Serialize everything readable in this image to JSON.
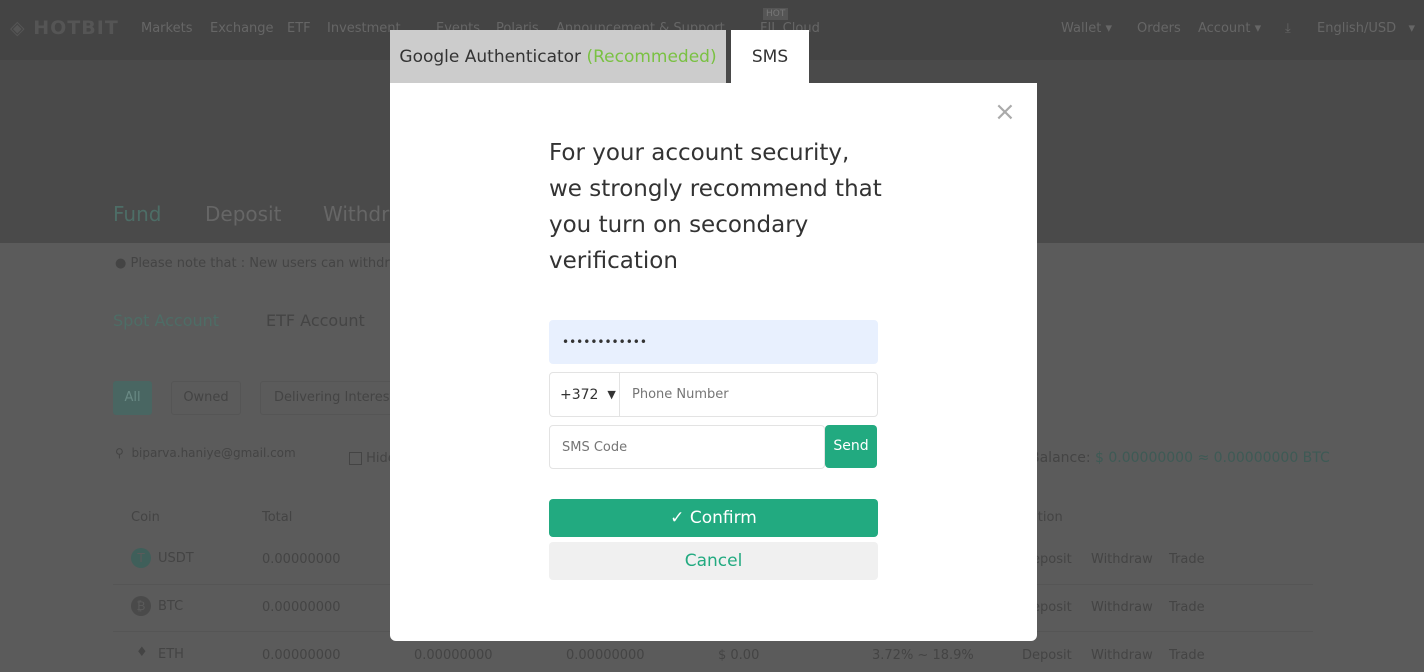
{
  "nav": {
    "logo": "HOTBIT",
    "items": [
      "Markets",
      "Exchange",
      "ETF",
      "Investment",
      "Events",
      "Polaris",
      "Announcement & Support",
      "FIL Cloud"
    ],
    "hot_badge": "HOT",
    "right": [
      "Wallet",
      "Orders",
      "Account",
      "English/USD"
    ]
  },
  "page": {
    "tabs": [
      "Fund",
      "Deposit",
      "Withdraw"
    ],
    "notice": "Please note that : New users can withdraw",
    "account_tabs": [
      "Spot Account",
      "ETF Account"
    ],
    "filters": [
      "All",
      "Owned",
      "Delivering Interest"
    ],
    "search_value": "biparva.haniye@gmail.com",
    "hide_label": "Hide",
    "balance_label": "Balance:",
    "balance_value": "$ 0.00000000 ≈ 0.00000000 BTC",
    "headers": {
      "coin": "Coin",
      "total": "Total",
      "action": "Action"
    },
    "rows": [
      {
        "coin": "USDT",
        "total": "0.00000000",
        "actions": [
          "Deposit",
          "Withdraw",
          "Trade"
        ]
      },
      {
        "coin": "BTC",
        "total": "0.00000000",
        "actions": [
          "Deposit",
          "Withdraw",
          "Trade"
        ]
      },
      {
        "coin": "ETH",
        "total": "0.00000000",
        "c3": "0.00000000",
        "c4": "0.00000000",
        "c5": "$ 0.00",
        "c6": "3.72% ~ 18.9%",
        "actions": [
          "Deposit",
          "Withdraw",
          "Trade"
        ]
      }
    ]
  },
  "modal": {
    "tab_google": "Google Authenticator",
    "tab_google_note": "(Recommeded)",
    "tab_sms": "SMS",
    "message": "For your account security, we strongly recommend that you turn on secondary verification",
    "password_value": "••••••••••••",
    "country_code": "+372",
    "phone_placeholder": "Phone Number",
    "sms_placeholder": "SMS Code",
    "send": "Send",
    "confirm": "✓ Confirm",
    "cancel": "Cancel"
  },
  "colors": {
    "accent": "#22aa80",
    "recommended": "#7ac143",
    "autofill": "#e8f0fe"
  }
}
